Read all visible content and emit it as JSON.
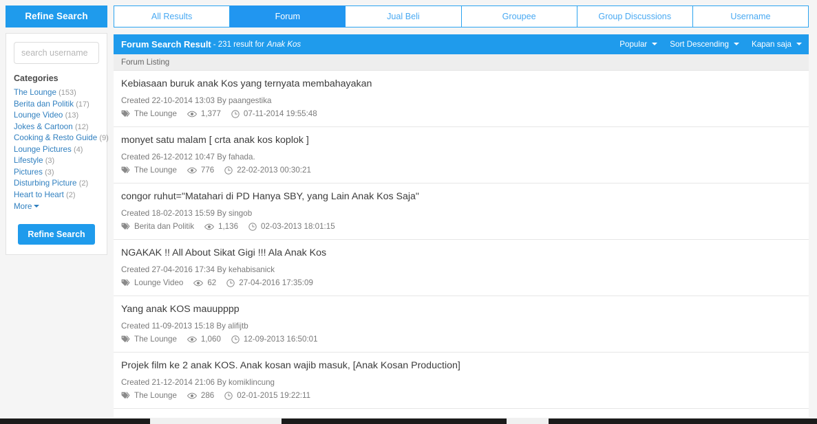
{
  "sidebar": {
    "refine_header": "Refine Search",
    "search": {
      "placeholder": "search username",
      "value": ""
    },
    "categories_title": "Categories",
    "categories": [
      {
        "label": "The Lounge",
        "count": "(153)"
      },
      {
        "label": "Berita dan Politik",
        "count": "(17)"
      },
      {
        "label": "Lounge Video",
        "count": "(13)"
      },
      {
        "label": "Jokes & Cartoon",
        "count": "(12)"
      },
      {
        "label": "Cooking & Resto Guide",
        "count": "(9)"
      },
      {
        "label": "Lounge Pictures",
        "count": "(4)"
      },
      {
        "label": "Lifestyle",
        "count": "(3)"
      },
      {
        "label": "Pictures",
        "count": "(3)"
      },
      {
        "label": "Disturbing Picture",
        "count": "(2)"
      },
      {
        "label": "Heart to Heart",
        "count": "(2)"
      }
    ],
    "more_label": "More",
    "refine_button": "Refine Search"
  },
  "tabs": [
    {
      "label": "All Results",
      "active": false
    },
    {
      "label": "Forum",
      "active": true
    },
    {
      "label": "Jual Beli",
      "active": false
    },
    {
      "label": "Groupee",
      "active": false
    },
    {
      "label": "Group Discussions",
      "active": false
    },
    {
      "label": "Username",
      "active": false
    }
  ],
  "panel": {
    "title": "Forum Search Result",
    "subtitle": "- 231 result for",
    "query": "Anak Kos",
    "sorts": [
      {
        "label": "Popular"
      },
      {
        "label": "Sort Descending"
      },
      {
        "label": "Kapan saja"
      }
    ],
    "listing_label": "Forum Listing"
  },
  "results": [
    {
      "title": "Kebiasaan buruk anak Kos yang ternyata membahayakan",
      "created": "Created 22-10-2014 13:03 By paangestika",
      "category": "The Lounge",
      "views": "1,377",
      "last_post": "07-11-2014 19:55:48"
    },
    {
      "title": "monyet satu malam [ crta anak kos koplok ]",
      "created": "Created 26-12-2012 10:47 By fahada.",
      "category": "The Lounge",
      "views": "776",
      "last_post": "22-02-2013 00:30:21"
    },
    {
      "title": "congor ruhut=\"Matahari di PD Hanya SBY, yang Lain Anak Kos Saja\"",
      "created": "Created 18-02-2013 15:59 By singob",
      "category": "Berita dan Politik",
      "views": "1,136",
      "last_post": "02-03-2013 18:01:15"
    },
    {
      "title": "NGAKAK !! All About Sikat Gigi !!! Ala Anak Kos",
      "created": "Created 27-04-2016 17:34 By kehabisanick",
      "category": "Lounge Video",
      "views": "62",
      "last_post": "27-04-2016 17:35:09"
    },
    {
      "title": "Yang anak KOS mauupppp",
      "created": "Created 11-09-2013 15:18 By alifijtb",
      "category": "The Lounge",
      "views": "1,060",
      "last_post": "12-09-2013 16:50:01"
    },
    {
      "title": "Projek film ke 2 anak KOS. Anak kosan wajib masuk, [Anak Kosan Production]",
      "created": "Created 21-12-2014 21:06 By komiklincung",
      "category": "The Lounge",
      "views": "286",
      "last_post": "02-01-2015 19:22:11"
    }
  ],
  "icons": {
    "tag": "tag-icon",
    "eye": "eye-icon",
    "clock": "clock-icon"
  },
  "colors": {
    "brand_blue": "#1f9bec",
    "tab_blue": "#2196f0",
    "link_blue": "#2f7fbf",
    "panel_bg": "#ffffff",
    "page_bg": "#f5f5f5"
  }
}
